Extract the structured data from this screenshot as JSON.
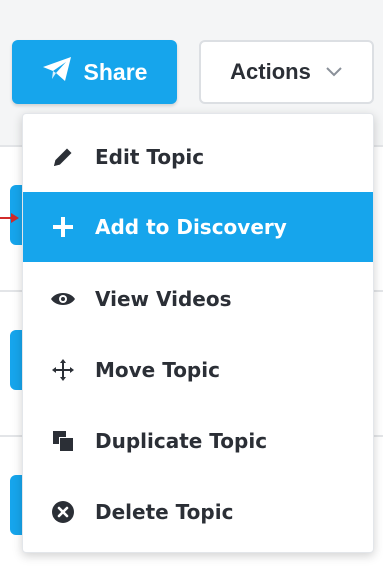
{
  "toolbar": {
    "share_label": "Share",
    "actions_label": "Actions"
  },
  "menu": {
    "items": [
      {
        "label": "Edit Topic",
        "icon": "pencil-icon",
        "active": false
      },
      {
        "label": "Add to Discovery",
        "icon": "plus-icon",
        "active": true
      },
      {
        "label": "View Videos",
        "icon": "eye-icon",
        "active": false
      },
      {
        "label": "Move Topic",
        "icon": "move-arrows-icon",
        "active": false
      },
      {
        "label": "Duplicate Topic",
        "icon": "duplicate-icon",
        "active": false
      },
      {
        "label": "Delete Topic",
        "icon": "close-circle-icon",
        "active": false
      }
    ]
  },
  "colors": {
    "accent": "#16a5ec",
    "text": "#2b2f36",
    "annotation_arrow": "#d12b2b"
  }
}
